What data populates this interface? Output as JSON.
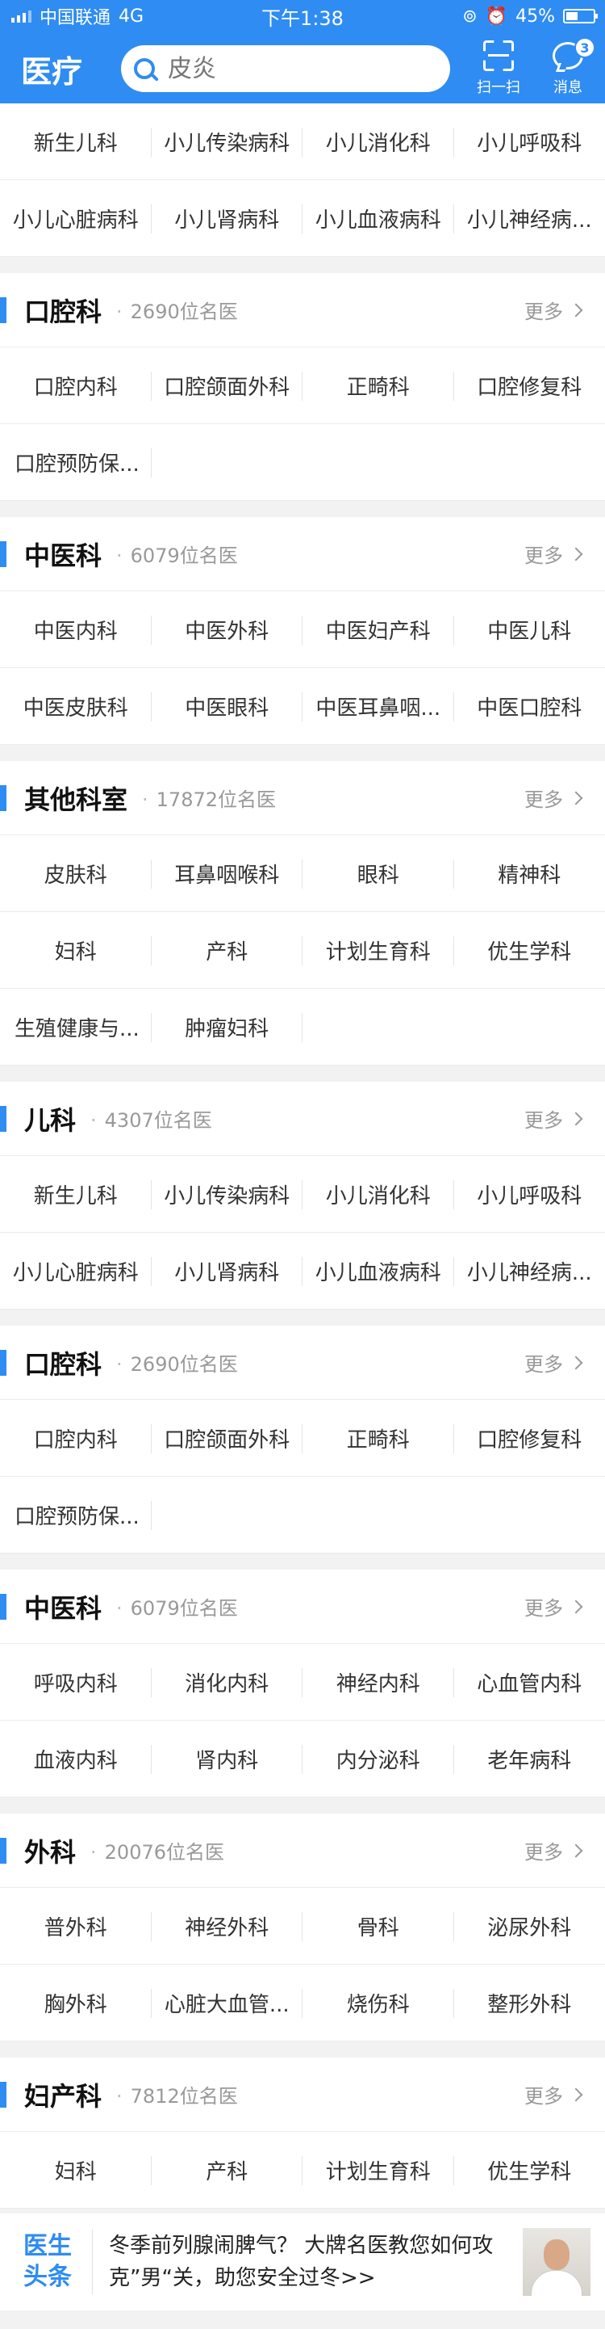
{
  "status_bar": {
    "carrier": "中国联通",
    "network": "4G",
    "time": "下午1:38",
    "battery": "45%",
    "battery_level": 0.45
  },
  "header": {
    "title": "医疗",
    "search_placeholder": "皮炎",
    "scan_label": "扫一扫",
    "message_label": "消息",
    "message_badge": "3"
  },
  "sections": [
    {
      "title": "",
      "count": "",
      "more": "",
      "items": [
        "新生儿科",
        "小儿传染病科",
        "小儿消化科",
        "小儿呼吸科",
        "小儿心脏病科",
        "小儿肾病科",
        "小儿血液病科",
        "小儿神经病..."
      ]
    },
    {
      "title": "口腔科",
      "count": "2690位名医",
      "more": "更多",
      "items": [
        "口腔内科",
        "口腔颌面外科",
        "正畸科",
        "口腔修复科",
        "口腔预防保..."
      ]
    },
    {
      "title": "中医科",
      "count": "6079位名医",
      "more": "更多",
      "items": [
        "中医内科",
        "中医外科",
        "中医妇产科",
        "中医儿科",
        "中医皮肤科",
        "中医眼科",
        "中医耳鼻咽...",
        "中医口腔科"
      ]
    },
    {
      "title": "其他科室",
      "count": "17872位名医",
      "more": "更多",
      "items": [
        "皮肤科",
        "耳鼻咽喉科",
        "眼科",
        "精神科",
        "妇科",
        "产科",
        "计划生育科",
        "优生学科",
        "生殖健康与...",
        "肿瘤妇科"
      ]
    },
    {
      "title": "儿科",
      "count": "4307位名医",
      "more": "更多",
      "items": [
        "新生儿科",
        "小儿传染病科",
        "小儿消化科",
        "小儿呼吸科",
        "小儿心脏病科",
        "小儿肾病科",
        "小儿血液病科",
        "小儿神经病..."
      ]
    },
    {
      "title": "口腔科",
      "count": "2690位名医",
      "more": "更多",
      "items": [
        "口腔内科",
        "口腔颌面外科",
        "正畸科",
        "口腔修复科",
        "口腔预防保..."
      ]
    },
    {
      "title": "中医科",
      "count": "6079位名医",
      "more": "更多",
      "items": [
        "呼吸内科",
        "消化内科",
        "神经内科",
        "心血管内科",
        "血液内科",
        "肾内科",
        "内分泌科",
        "老年病科"
      ]
    },
    {
      "title": "外科",
      "count": "20076位名医",
      "more": "更多",
      "items": [
        "普外科",
        "神经外科",
        "骨科",
        "泌尿外科",
        "胸外科",
        "心脏大血管...",
        "烧伤科",
        "整形外科"
      ]
    },
    {
      "title": "妇产科",
      "count": "7812位名医",
      "more": "更多",
      "items": [
        "妇科",
        "产科",
        "计划生育科",
        "优生学科"
      ]
    }
  ],
  "news": {
    "logo_line1": "医生",
    "logo_line2": "头条",
    "text": "冬季前列腺闹脾气？ 大牌名医教您如何攻克”男“关，助您安全过冬>>"
  }
}
